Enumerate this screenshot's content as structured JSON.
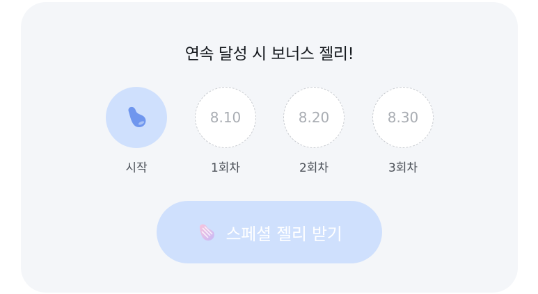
{
  "title": "연속 달성 시 보너스 젤리!",
  "steps": [
    {
      "label": "시작",
      "date": "",
      "state": "active",
      "icon": "jelly-bean-icon"
    },
    {
      "label": "1회차",
      "date": "8.10",
      "state": "pending"
    },
    {
      "label": "2회차",
      "date": "8.20",
      "state": "pending"
    },
    {
      "label": "3회차",
      "date": "8.30",
      "state": "pending"
    }
  ],
  "cta": {
    "label": "스페셜 젤리 받기",
    "icon": "special-jelly-icon",
    "enabled": false
  },
  "colors": {
    "card_bg": "#f4f6f9",
    "accent_light": "#cfe0fd",
    "jelly_blue": "#6f96ee",
    "special_jelly_pink": "#f2a6cf",
    "special_jelly_purple": "#b8a6f2"
  }
}
